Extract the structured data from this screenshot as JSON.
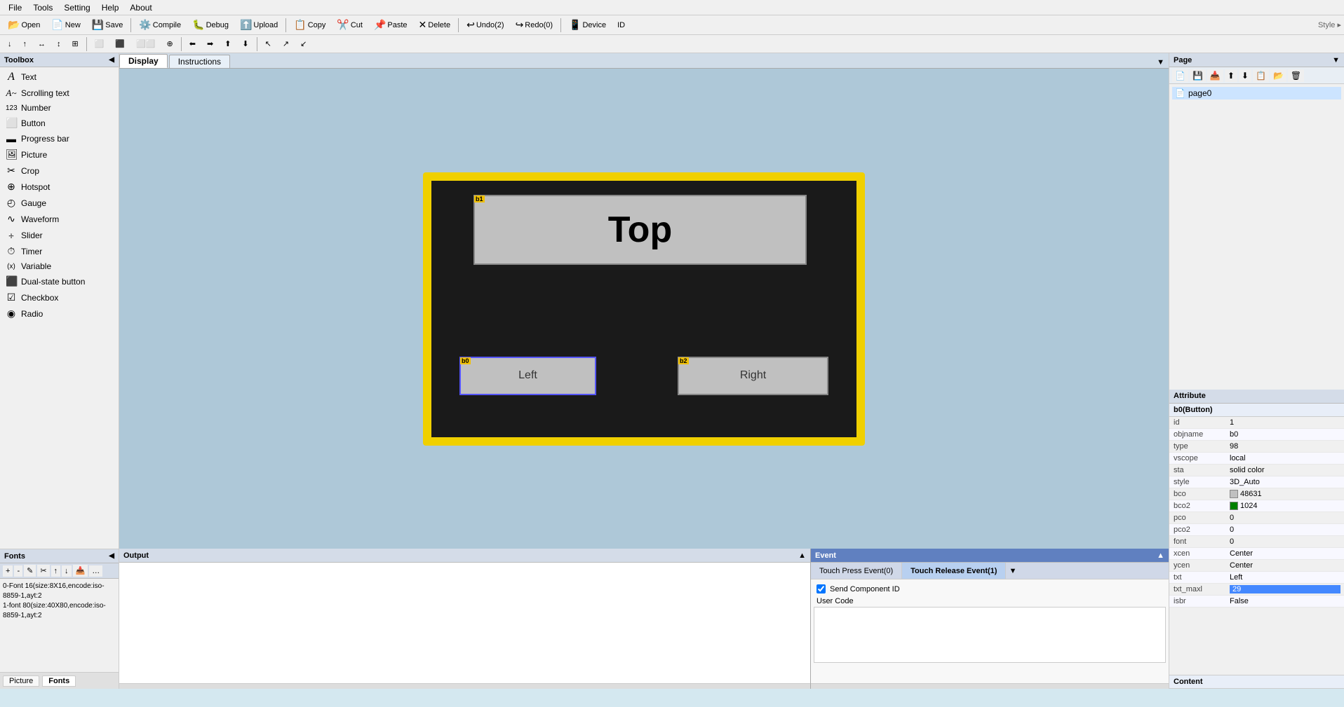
{
  "menu": {
    "items": [
      "File",
      "Tools",
      "Setting",
      "Help",
      "About"
    ]
  },
  "toolbar": {
    "buttons": [
      {
        "label": "Open",
        "icon": "📂"
      },
      {
        "label": "New",
        "icon": "📄"
      },
      {
        "label": "Save",
        "icon": "💾"
      },
      {
        "label": "Compile",
        "icon": "⚙️"
      },
      {
        "label": "Debug",
        "icon": "🐛"
      },
      {
        "label": "Upload",
        "icon": "⬆️"
      },
      {
        "label": "Copy",
        "icon": "📋"
      },
      {
        "label": "Cut",
        "icon": "✂️"
      },
      {
        "label": "Paste",
        "icon": "📌"
      },
      {
        "label": "Delete",
        "icon": "✕"
      },
      {
        "label": "Undo(2)",
        "icon": "↩"
      },
      {
        "label": "Redo(0)",
        "icon": "↪"
      },
      {
        "label": "Device",
        "icon": "📱"
      },
      {
        "label": "ID",
        "icon": "#"
      }
    ]
  },
  "toolbox": {
    "title": "Toolbox",
    "items": [
      {
        "label": "Text",
        "icon": "A"
      },
      {
        "label": "Scrolling text",
        "icon": "A~"
      },
      {
        "label": "Number",
        "icon": "123"
      },
      {
        "label": "Button",
        "icon": "⬜"
      },
      {
        "label": "Progress bar",
        "icon": "▬"
      },
      {
        "label": "Picture",
        "icon": "🖼"
      },
      {
        "label": "Crop",
        "icon": "✂"
      },
      {
        "label": "Hotspot",
        "icon": "⊕"
      },
      {
        "label": "Gauge",
        "icon": "◴"
      },
      {
        "label": "Waveform",
        "icon": "∿"
      },
      {
        "label": "Slider",
        "icon": "⧾"
      },
      {
        "label": "Timer",
        "icon": "⏱"
      },
      {
        "label": "Variable",
        "icon": "(x)"
      },
      {
        "label": "Dual-state button",
        "icon": "⬛"
      },
      {
        "label": "Checkbox",
        "icon": "☑"
      },
      {
        "label": "Radio",
        "icon": "◉"
      }
    ]
  },
  "fonts": {
    "title": "Fonts",
    "items": [
      "0-Font 16(size:8X16,encode:iso-8859-1,ayt:2",
      "1-font 80(size:40X80,encode:iso-8859-1,ayt:2"
    ]
  },
  "tabs": {
    "display_label": "Display",
    "instructions_label": "Instructions"
  },
  "canvas": {
    "button_b1": {
      "label": "b1",
      "text": "Top"
    },
    "button_b0": {
      "label": "b0",
      "text": "Left"
    },
    "button_b2": {
      "label": "b2",
      "text": "Right"
    }
  },
  "page_panel": {
    "title": "Page",
    "page0_label": "page0"
  },
  "output": {
    "title": "Output",
    "tabs": [
      "Picture",
      "Fonts"
    ]
  },
  "event": {
    "title": "Event",
    "tab_press": "Touch Press Event(0)",
    "tab_release": "Touch Release Event(1)",
    "send_component_id": "Send Component ID",
    "user_code_label": "User Code"
  },
  "attribute": {
    "title": "Attribute",
    "component_label": "b0(Button)",
    "rows": [
      {
        "key": "id",
        "value": "1"
      },
      {
        "key": "objname",
        "value": "b0"
      },
      {
        "key": "type",
        "value": "98"
      },
      {
        "key": "vscope",
        "value": "local"
      },
      {
        "key": "sta",
        "value": "solid color"
      },
      {
        "key": "style",
        "value": "3D_Auto"
      },
      {
        "key": "bco",
        "value": "48631",
        "color": "#c0c0c0"
      },
      {
        "key": "bco2",
        "value": "1024",
        "color": "#008000"
      },
      {
        "key": "pco",
        "value": "0"
      },
      {
        "key": "pco2",
        "value": "0"
      },
      {
        "key": "font",
        "value": "0"
      },
      {
        "key": "xcen",
        "value": "Center"
      },
      {
        "key": "ycen",
        "value": "Center"
      },
      {
        "key": "txt",
        "value": "Left"
      },
      {
        "key": "txt_maxl",
        "value": "29",
        "highlight": true
      },
      {
        "key": "isbr",
        "value": "False"
      }
    ],
    "content_label": "Content"
  }
}
